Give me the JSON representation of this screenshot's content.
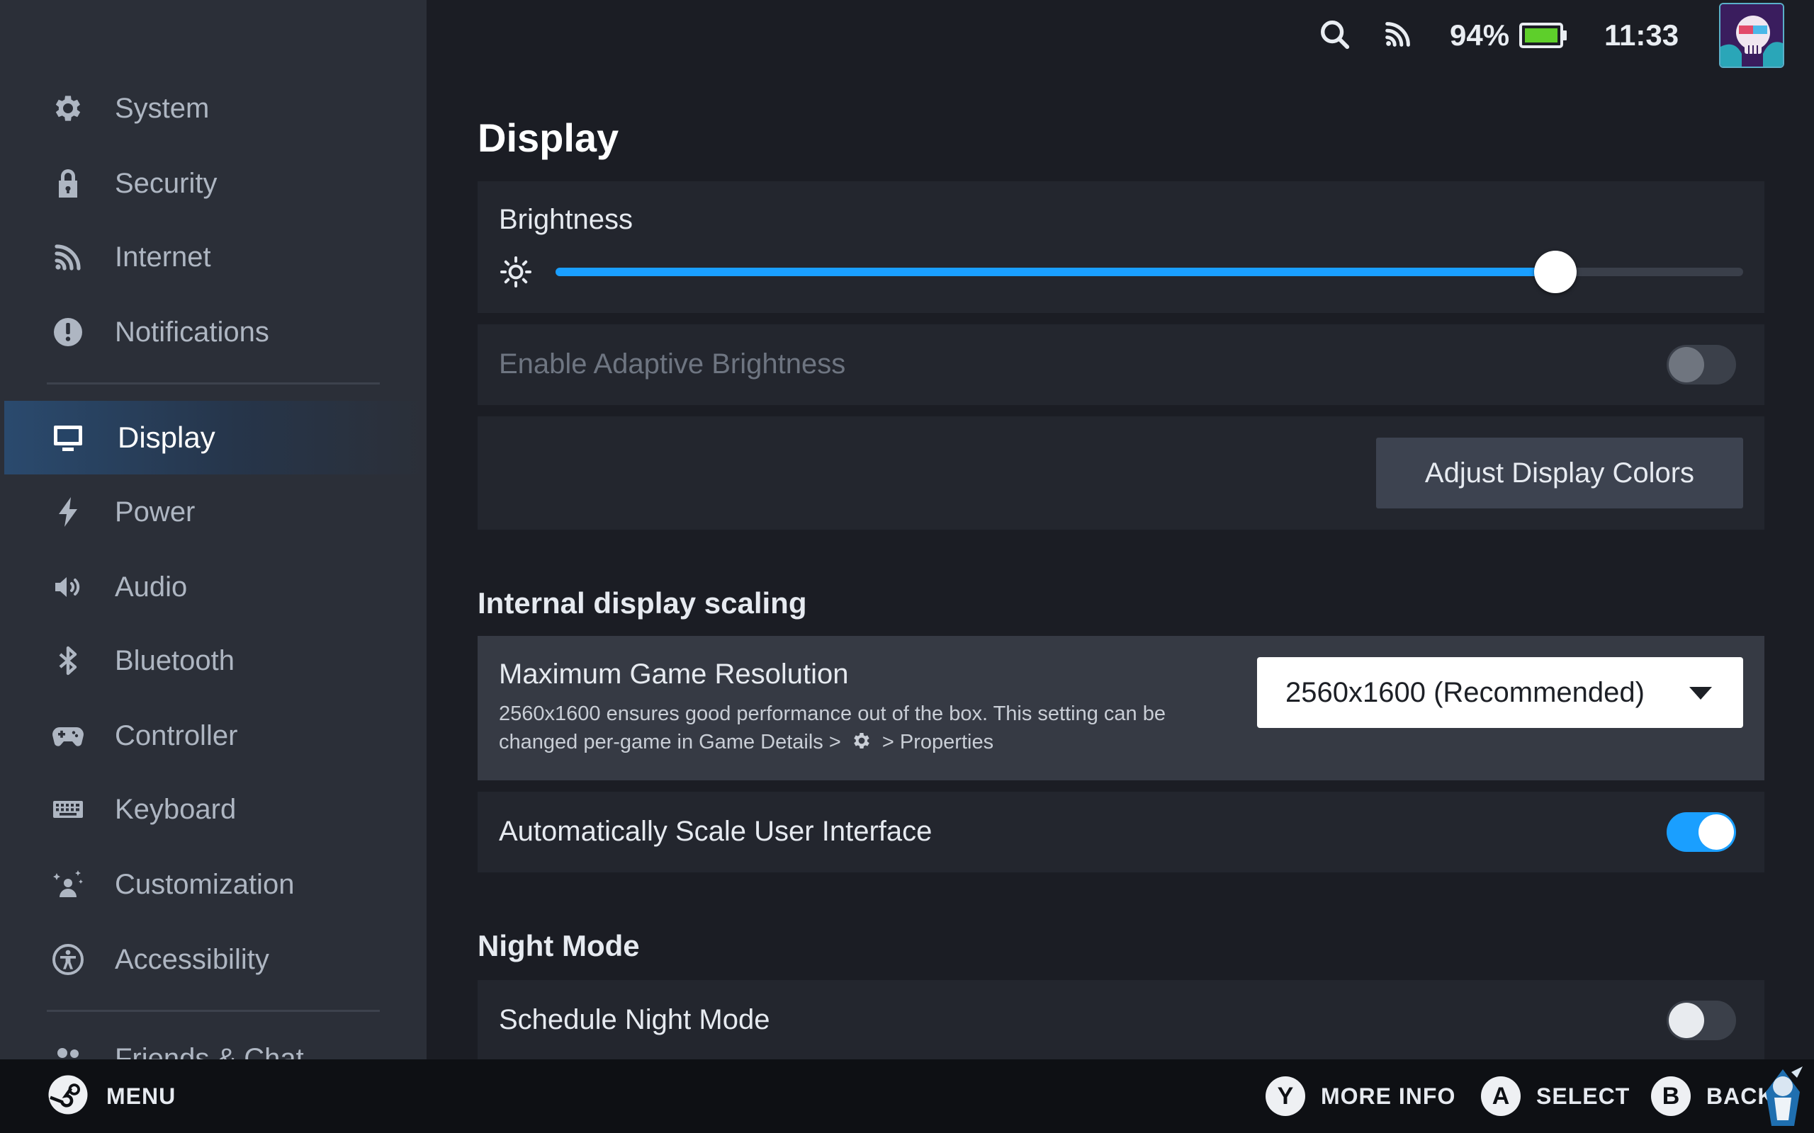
{
  "sidebar": {
    "items": [
      {
        "label": "System",
        "icon": "gear-icon"
      },
      {
        "label": "Security",
        "icon": "lock-icon"
      },
      {
        "label": "Internet",
        "icon": "wifi-icon"
      },
      {
        "label": "Notifications",
        "icon": "alert-icon"
      },
      {
        "label": "Display",
        "icon": "monitor-icon"
      },
      {
        "label": "Power",
        "icon": "lightning-icon"
      },
      {
        "label": "Audio",
        "icon": "speaker-icon"
      },
      {
        "label": "Bluetooth",
        "icon": "bluetooth-icon"
      },
      {
        "label": "Controller",
        "icon": "gamepad-icon"
      },
      {
        "label": "Keyboard",
        "icon": "keyboard-icon"
      },
      {
        "label": "Customization",
        "icon": "sparkle-person-icon"
      },
      {
        "label": "Accessibility",
        "icon": "accessibility-icon"
      },
      {
        "label": "Friends & Chat",
        "icon": "friends-icon"
      }
    ],
    "active_index": 4
  },
  "topbar": {
    "battery_percent": "94%",
    "time": "11:33"
  },
  "main": {
    "title": "Display",
    "brightness": {
      "label": "Brightness",
      "value_fraction": 0.842
    },
    "adaptive": {
      "label": "Enable Adaptive Brightness",
      "enabled": false,
      "disabled": true
    },
    "adjust_colors_button": "Adjust Display Colors",
    "scaling_section": "Internal display scaling",
    "max_resolution": {
      "label": "Maximum Game Resolution",
      "desc_part1": "2560x1600 ensures good performance out of the box. This setting can be changed per-game in Game Details >",
      "desc_part2": "> Properties",
      "selected": "2560x1600 (Recommended)"
    },
    "auto_scale": {
      "label": "Automatically Scale User Interface",
      "enabled": true
    },
    "night_section": "Night Mode",
    "schedule_night": {
      "label": "Schedule Night Mode",
      "enabled": false
    }
  },
  "bottombar": {
    "menu_label": "MENU",
    "y_key": "Y",
    "y_label": "MORE INFO",
    "a_key": "A",
    "a_label": "SELECT",
    "b_key": "B",
    "b_label": "BACK"
  },
  "colors": {
    "accent": "#1a9fff",
    "sidebar_bg": "#2b2f38",
    "main_bg": "#1b1d24",
    "battery": "#5ecf2b"
  }
}
